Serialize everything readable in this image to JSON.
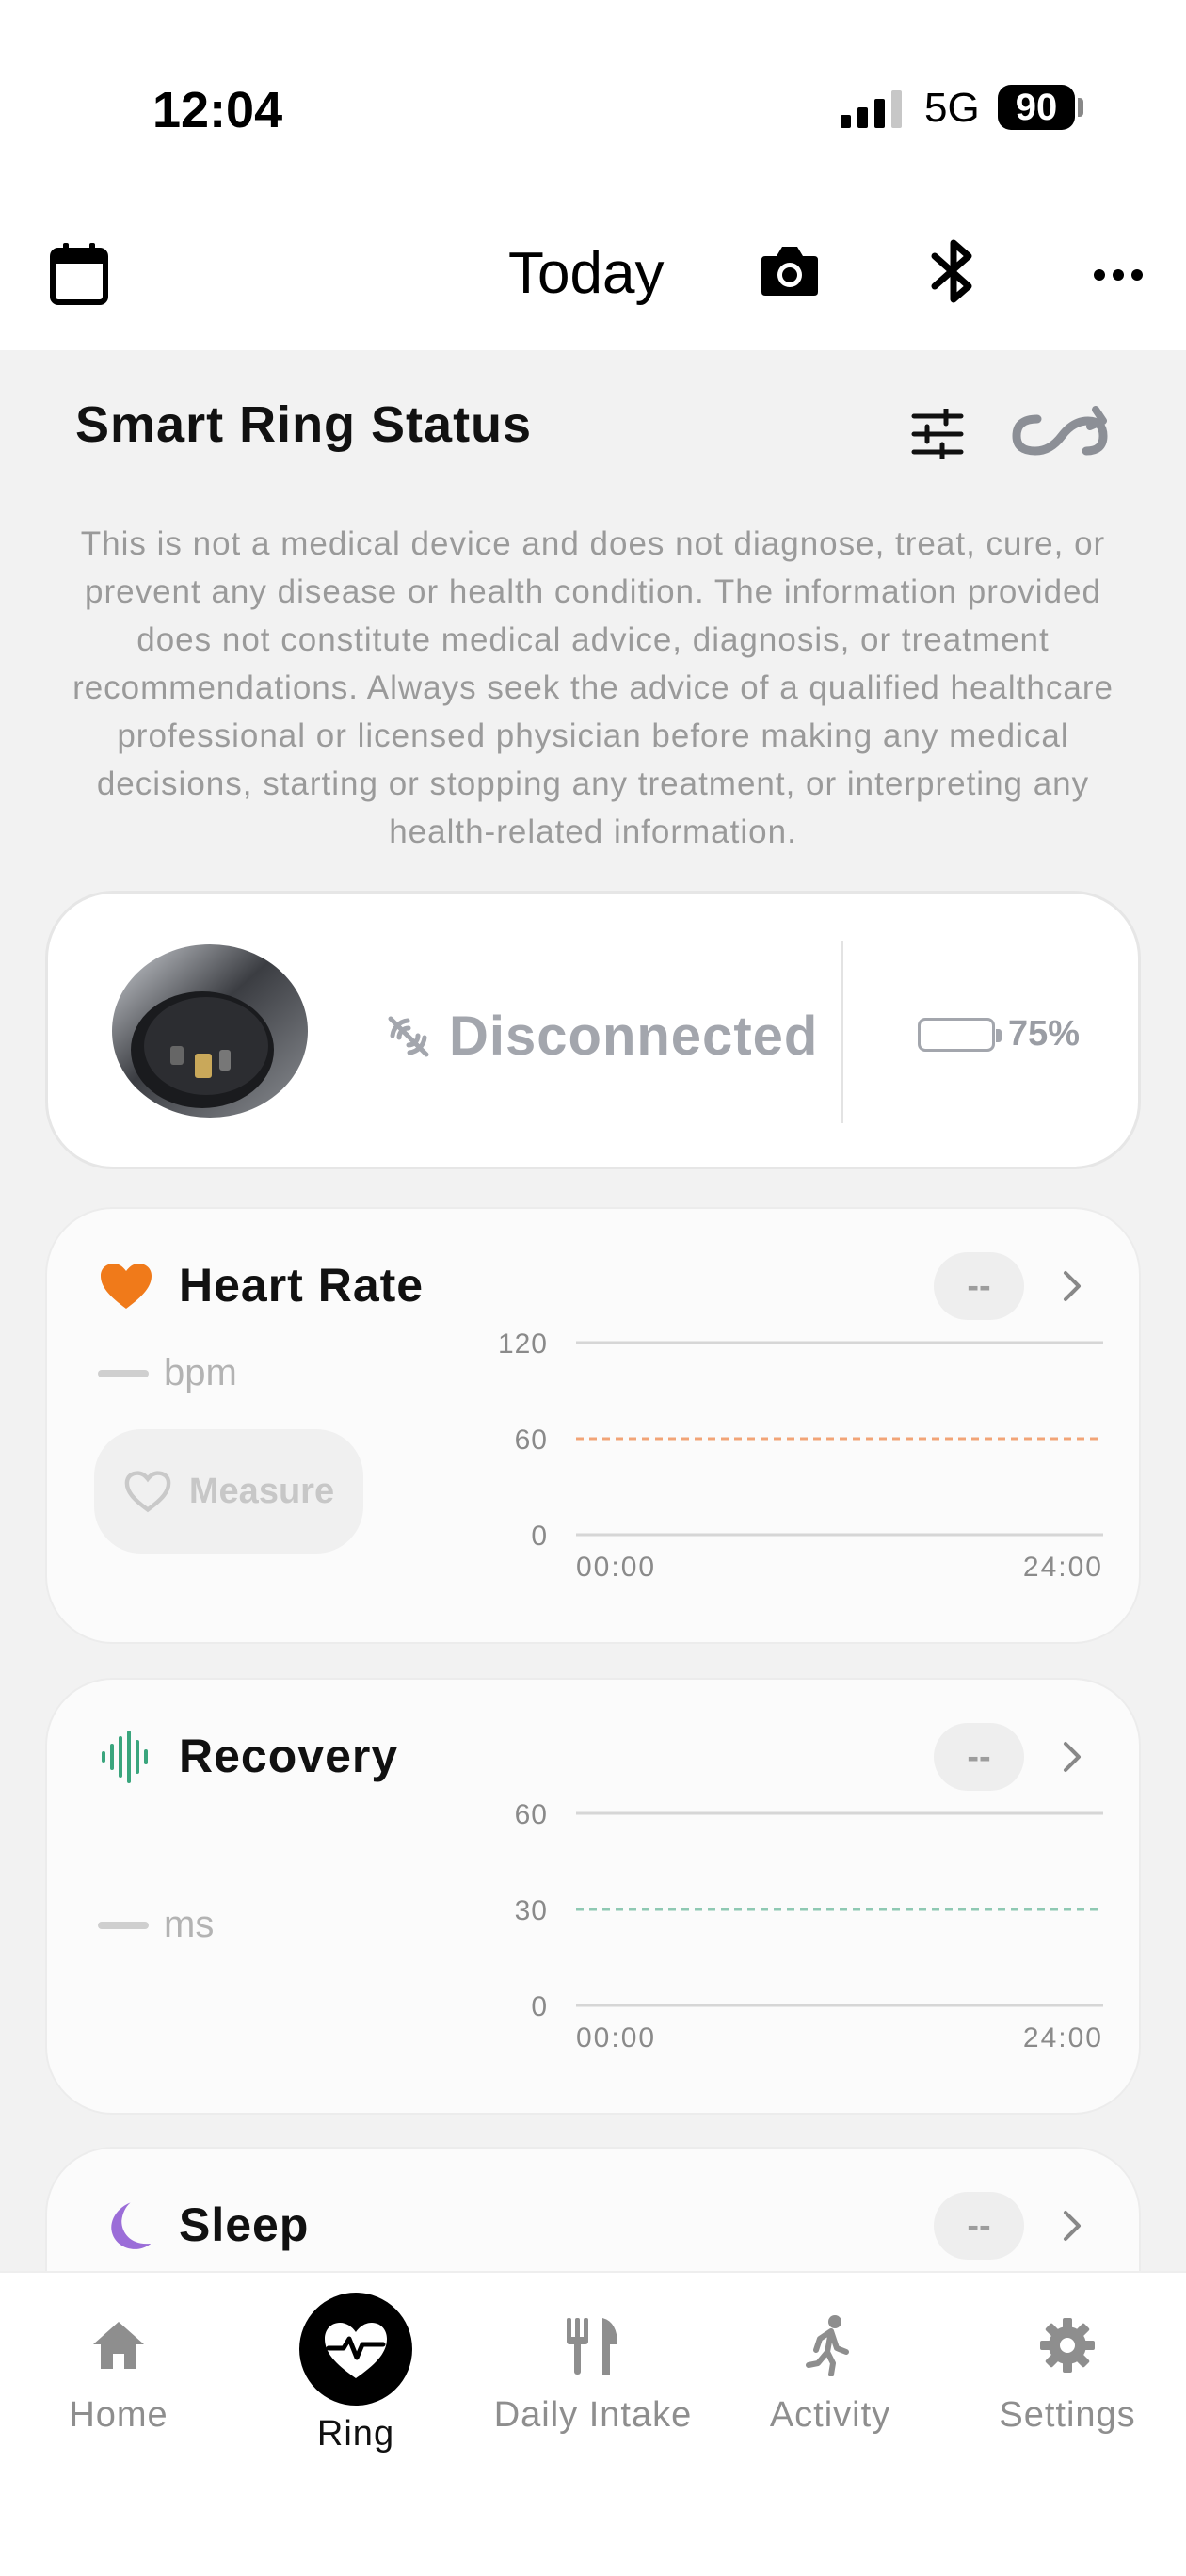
{
  "status_bar": {
    "time": "12:04",
    "network": "5G",
    "battery": "90"
  },
  "nav": {
    "title": "Today",
    "icons": [
      "calendar-icon",
      "camera-icon",
      "bluetooth-icon",
      "more-icon"
    ]
  },
  "section": {
    "title": "Smart Ring Status",
    "icons": [
      "sliders-icon",
      "sync-icon"
    ],
    "disclaimer": "This is not a medical device and does not diagnose, treat, cure, or prevent any disease or health condition. The information provided does not constitute medical advice, diagnosis, or treatment recommendations. Always seek the advice of a qualified healthcare professional or licensed physician before making any medical decisions, starting or stopping any treatment, or interpreting any health-related information."
  },
  "device": {
    "status": "Disconnected",
    "battery": "75%",
    "battery_level": 0.75
  },
  "heart_rate": {
    "title": "Heart Rate",
    "value": "--",
    "unit": "bpm",
    "measure_label": "Measure",
    "accent": "#f07a1a",
    "chart_data": {
      "type": "line",
      "y_ticks": [
        "120",
        "60",
        "0"
      ],
      "x_ticks": [
        "00:00",
        "24:00"
      ],
      "ylim": [
        0,
        120
      ],
      "reference_line": 60,
      "reference_color": "#f2a477",
      "values": []
    }
  },
  "recovery": {
    "title": "Recovery",
    "value": "--",
    "unit": "ms",
    "accent": "#3aa57d",
    "chart_data": {
      "type": "line",
      "y_ticks": [
        "60",
        "30",
        "0"
      ],
      "x_ticks": [
        "00:00",
        "24:00"
      ],
      "ylim": [
        0,
        60
      ],
      "reference_line": 30,
      "reference_color": "#8fc9b3",
      "values": []
    }
  },
  "sleep": {
    "title": "Sleep",
    "value": "--",
    "accent": "#9b6dd8"
  },
  "tabs": [
    {
      "label": "Home",
      "icon": "home-icon",
      "active": false
    },
    {
      "label": "Ring",
      "icon": "ring-heart-icon",
      "active": true
    },
    {
      "label": "Daily Intake",
      "icon": "fork-knife-icon",
      "active": false
    },
    {
      "label": "Activity",
      "icon": "running-icon",
      "active": false
    },
    {
      "label": "Settings",
      "icon": "gear-icon",
      "active": false
    }
  ]
}
